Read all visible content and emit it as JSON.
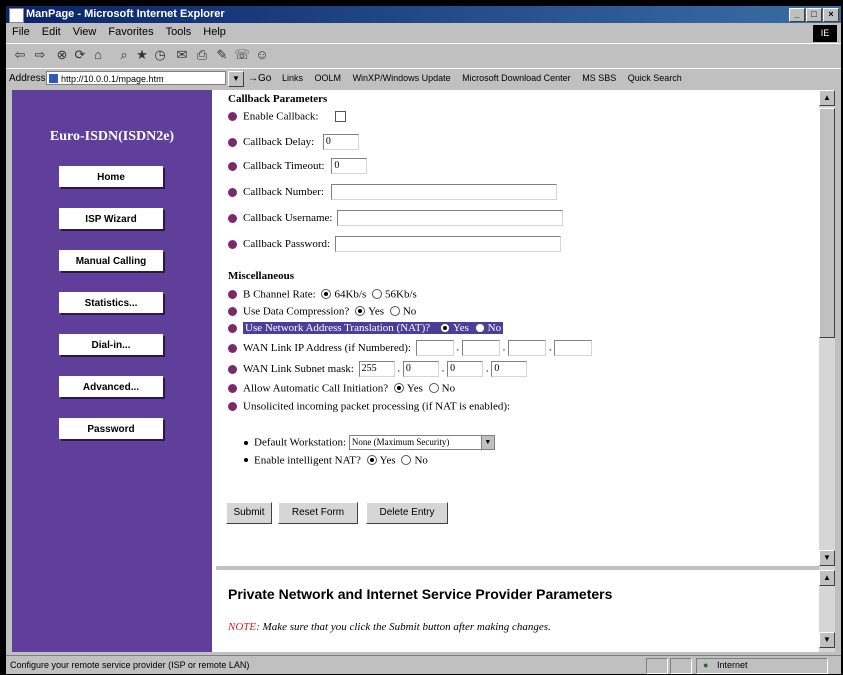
{
  "window": {
    "title": "ManPage - Microsoft Internet Explorer",
    "logo": "IE"
  },
  "menu": [
    "File",
    "Edit",
    "View",
    "Favorites",
    "Tools",
    "Help"
  ],
  "address": {
    "label": "Address",
    "url": "http://10.0.0.1/mpage.htm",
    "go": "Go"
  },
  "links": [
    "Links",
    "OOLM",
    "WinXP/Windows Update",
    "Microsoft Download Center",
    "MS SBS",
    "Quick Search"
  ],
  "sidebar": {
    "title": "Euro-ISDN(ISDN2e)",
    "items": [
      "Home",
      "ISP Wizard",
      "Manual Calling",
      "Statistics...",
      "Dial-in...",
      "Advanced...",
      "Password"
    ]
  },
  "callback": {
    "heading": "Callback Parameters",
    "enable_label": "Enable Callback:",
    "delay_label": "Callback Delay:",
    "delay_value": "0",
    "timeout_label": "Callback Timeout:",
    "timeout_value": "0",
    "number_label": "Callback Number:",
    "username_label": "Callback Username:",
    "password_label": "Callback Password:"
  },
  "misc": {
    "heading": "Miscellaneous",
    "bchannel_label": "B Channel Rate:",
    "bchannel_opt1": "64Kb/s",
    "bchannel_opt2": "56Kb/s",
    "compress_label": "Use Data Compression?",
    "nat_label": "Use Network Address Translation (NAT)?",
    "yes": "Yes",
    "no": "No",
    "wan_ip_label": "WAN Link IP Address (if Numbered):",
    "wan_mask_label": "WAN Link Subnet mask:",
    "mask": [
      "255",
      "0",
      "0",
      "0"
    ],
    "auto_call_label": "Allow Automatic Call Initiation?",
    "unsolicited_label": "Unsolicited incoming packet processing (if NAT is enabled):",
    "default_ws_label": "Default Workstation:",
    "default_ws_value": "None (Maximum Security)",
    "intelligent_nat_label": "Enable intelligent NAT?"
  },
  "form_buttons": {
    "submit": "Submit",
    "reset": "Reset Form",
    "delete": "Delete Entry"
  },
  "lower": {
    "heading": "Private Network and Internet Service Provider Parameters",
    "note_prefix": "NOTE:",
    "note_text": "Make sure that you click the Submit button after making changes."
  },
  "status": {
    "text": "Configure your remote service provider (ISP or remote LAN)",
    "zone": "Internet"
  },
  "colors": {
    "sidebar": "#5f3f9a",
    "highlight": "#4a3e9a",
    "bullet": "#7a2a6a",
    "note": "#cc2222"
  }
}
